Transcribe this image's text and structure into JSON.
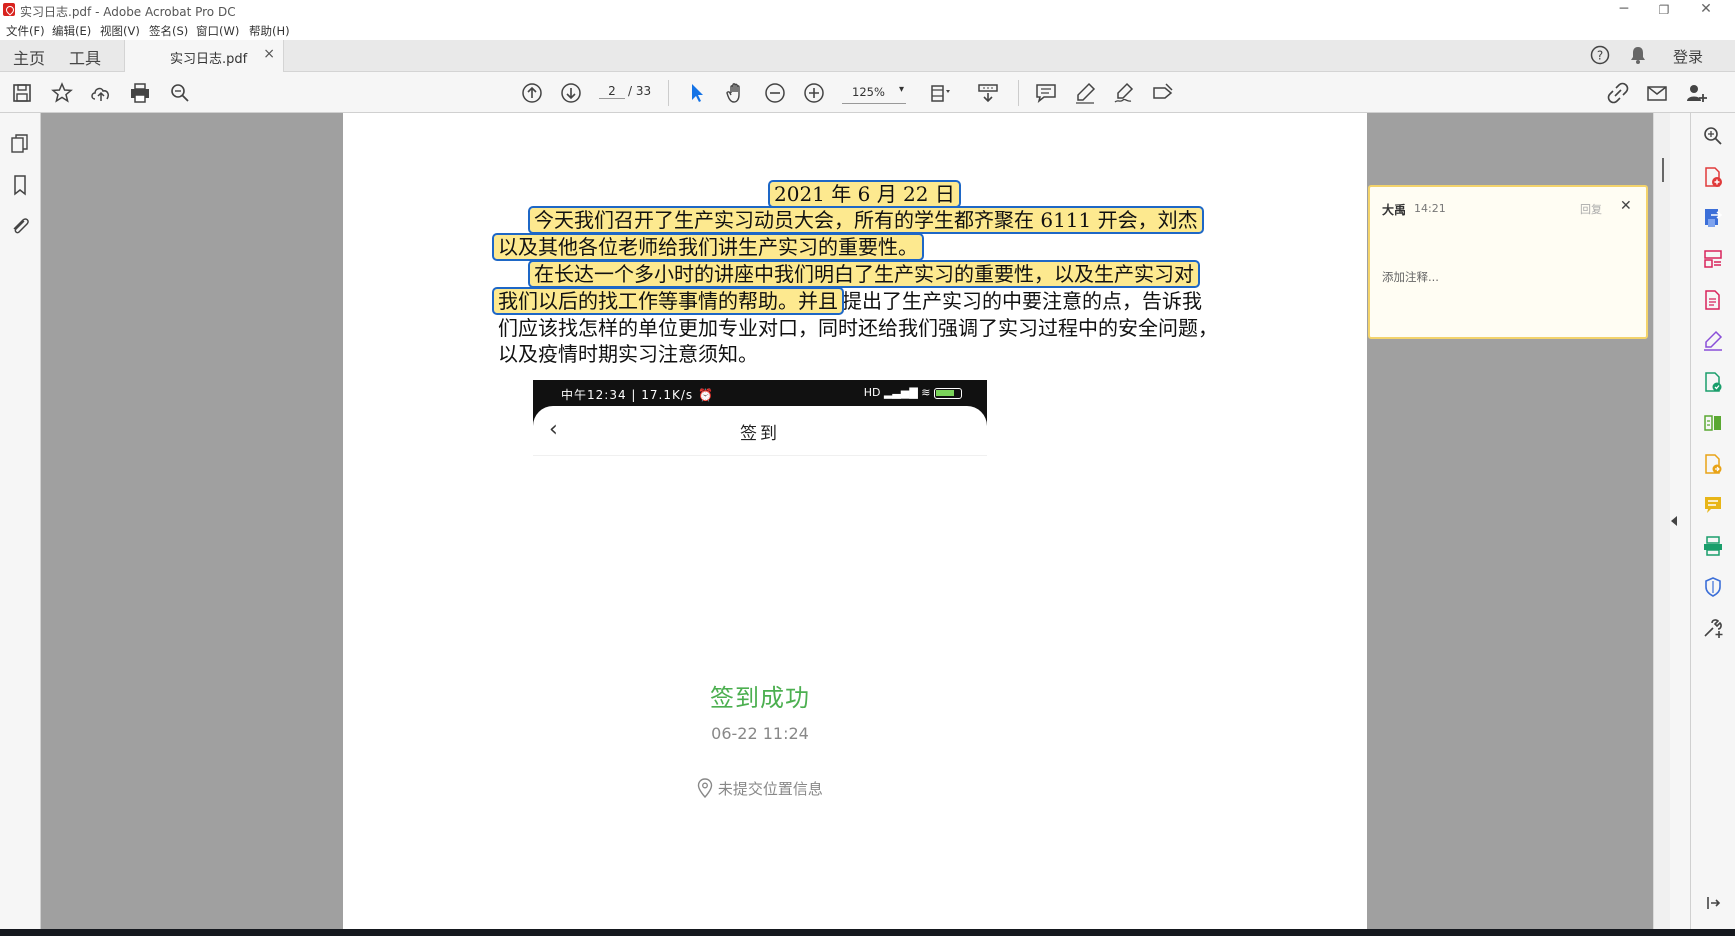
{
  "window": {
    "title": "实习日志.pdf - Adobe Acrobat Pro DC",
    "minimize": "─",
    "maximize": "❐",
    "close": "✕"
  },
  "menu": [
    "文件(F)",
    "编辑(E)",
    "视图(V)",
    "签名(S)",
    "窗口(W)",
    "帮助(H)"
  ],
  "tabs": {
    "home": "主页",
    "tools": "工具",
    "document": "实习日志.pdf",
    "close": "×",
    "login": "登录"
  },
  "toolbar": {
    "page_current": "2",
    "page_total": "/ 33",
    "zoom": "125%",
    "zoom_caret": "▾"
  },
  "document": {
    "date": "2021 年 6 月 22 日",
    "para1_line1": "今天我们召开了生产实习动员大会，所有的学生都齐聚在 6111 开会，刘杰",
    "para1_line2": "以及其他各位老师给我们讲生产实习的重要性。",
    "para2_line1": "在长达一个多小时的讲座中我们明白了生产实习的重要性，以及生产实习对",
    "para2_line2_hl": "我们以后的找工作等事情的帮助。并且",
    "para2_line2_rest": "提出了生产实习的中要注意的点，告诉我",
    "para2_line3": "们应该找怎样的单位更加专业对口，同时还给我们强调了实习过程中的安全问题，",
    "para2_line4": "以及疫情时期实习注意须知。"
  },
  "phone": {
    "status_left": "中午12:34 | 17.1K/s ⏰",
    "status_right": "HD ▂▃▅▇ ≋",
    "back": "‹",
    "title": "签到",
    "success": "签到成功",
    "time": "06-22 11:24",
    "location": "未提交位置信息"
  },
  "comment": {
    "author": "大禹",
    "time": "14:21",
    "reply": "回复",
    "close": "✕",
    "placeholder": "添加注释..."
  },
  "colors": {
    "highlight": "#fde98f",
    "selection_border": "#1e67c6",
    "success_green": "#4caf50",
    "comment_border": "#f3d36b"
  }
}
